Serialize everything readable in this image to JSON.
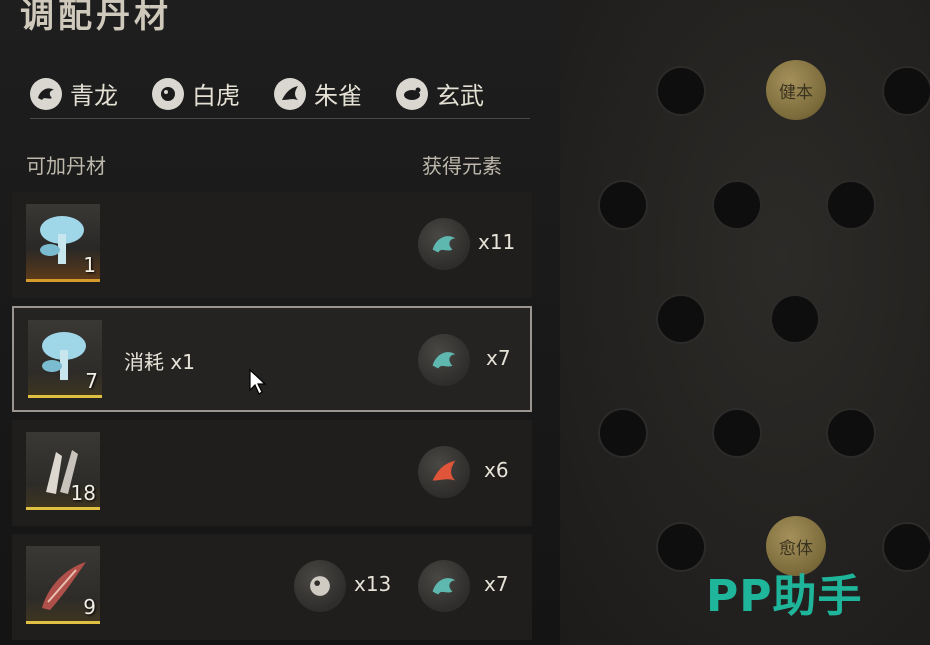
{
  "title": "调配丹材",
  "tabs": [
    {
      "label": "青龙",
      "icon": "dragon-icon"
    },
    {
      "label": "白虎",
      "icon": "tiger-icon"
    },
    {
      "label": "朱雀",
      "icon": "phoenix-icon"
    },
    {
      "label": "玄武",
      "icon": "tortoise-icon"
    }
  ],
  "headers": {
    "left": "可加丹材",
    "right": "获得元素"
  },
  "rows": [
    {
      "item": "blue-mushroom",
      "count": "1",
      "consume": "",
      "elements": [
        {
          "icon": "dragon-element-icon",
          "qty": "x11"
        }
      ]
    },
    {
      "item": "blue-mushroom",
      "count": "7",
      "consume": "消耗 x1",
      "elements": [
        {
          "icon": "dragon-element-icon",
          "qty": "x7"
        }
      ]
    },
    {
      "item": "white-claw",
      "count": "18",
      "consume": "",
      "elements": [
        {
          "icon": "phoenix-element-icon",
          "qty": "x6"
        }
      ]
    },
    {
      "item": "red-shrimp",
      "count": "9",
      "consume": "",
      "elements": [
        {
          "icon": "tiger-element-icon",
          "qty": "x13"
        },
        {
          "icon": "dragon-element-icon",
          "qty": "x7"
        }
      ]
    }
  ],
  "board": {
    "coin_top": "健本",
    "coin_bottom": "愈体"
  },
  "watermark": "PP助手",
  "colors": {
    "accent_green": "#1fb59b",
    "coin_gold": "#a4905a",
    "dragon_teal": "#5fb8b0",
    "phoenix_red": "#e0553a"
  }
}
